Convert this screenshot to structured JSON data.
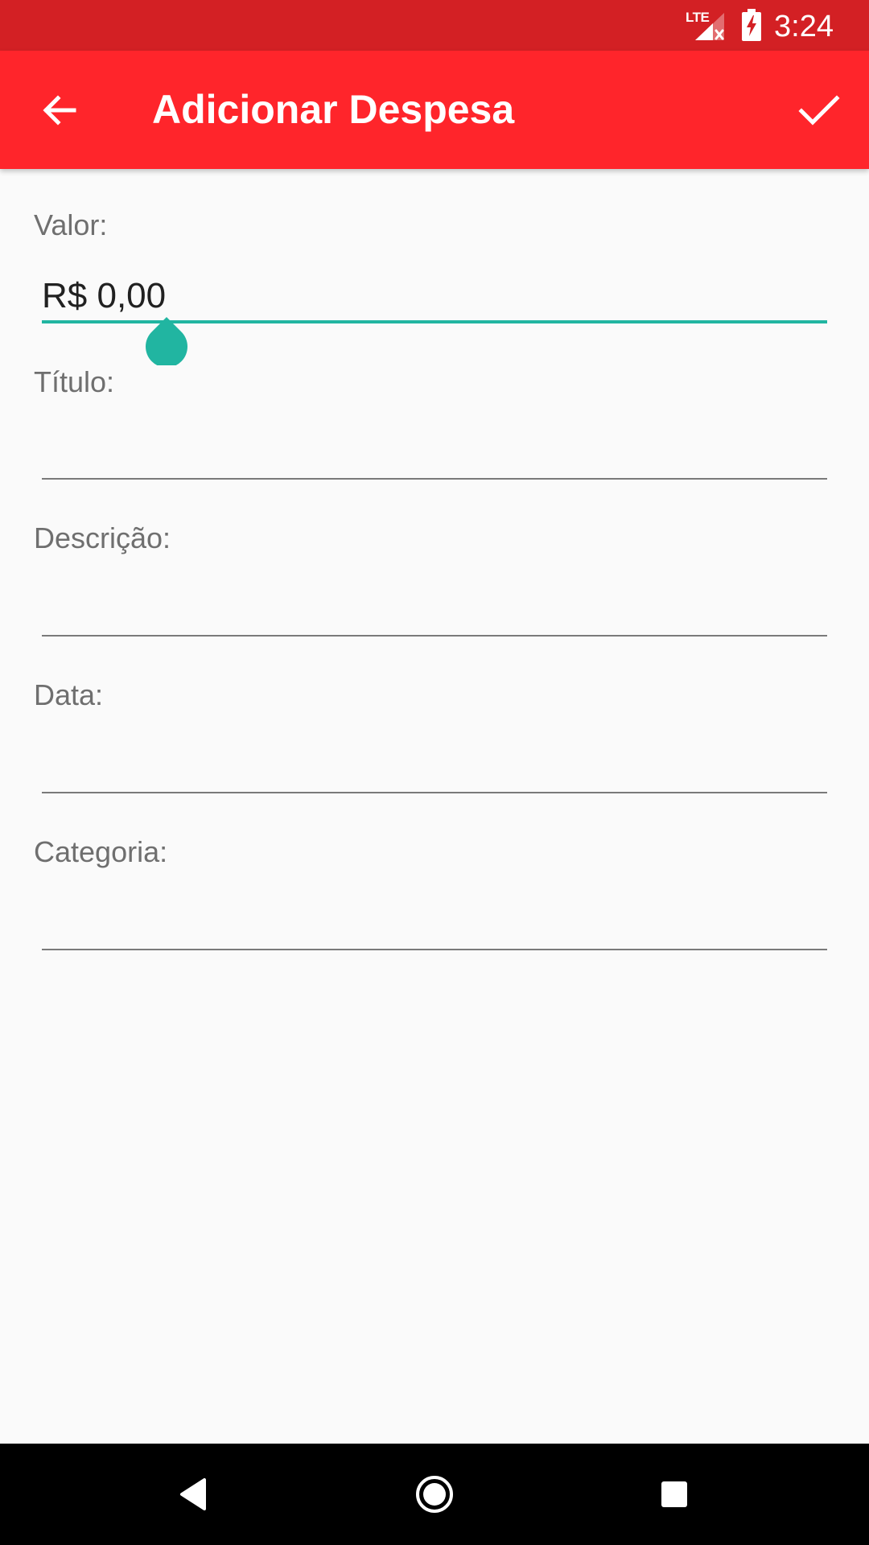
{
  "status_bar": {
    "network_label": "LTE",
    "time": "3:24",
    "icons": [
      "signal-no-data-icon",
      "battery-charging-icon"
    ]
  },
  "app_bar": {
    "title": "Adicionar Despesa",
    "back_icon": "arrow-back-icon",
    "confirm_icon": "check-icon",
    "background_color": "#ff252b"
  },
  "form": {
    "valor": {
      "label": "Valor:",
      "value": "R$ 0,00",
      "focused": true
    },
    "titulo": {
      "label": "Título:",
      "value": ""
    },
    "descricao": {
      "label": "Descrição:",
      "value": ""
    },
    "data": {
      "label": "Data:",
      "value": ""
    },
    "categoria": {
      "label": "Categoria:",
      "value": ""
    },
    "accent_color": "#21b5a1"
  },
  "nav_bar": {
    "buttons": [
      "back-triangle-icon",
      "home-circle-icon",
      "recents-square-icon"
    ]
  }
}
